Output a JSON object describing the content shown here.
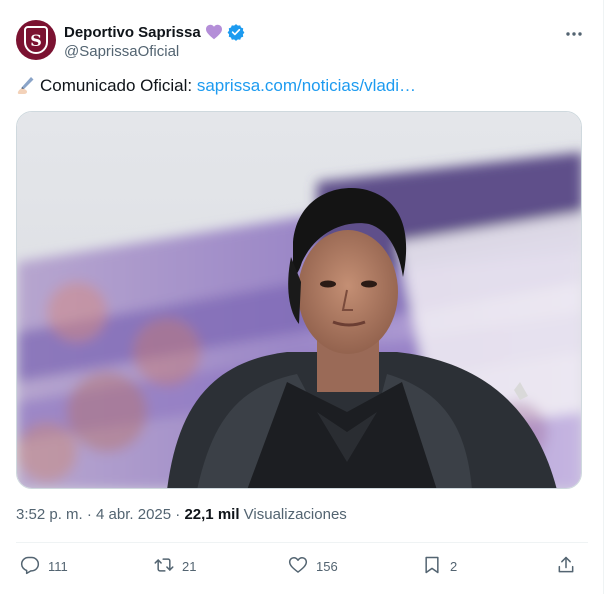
{
  "tweet": {
    "author": {
      "display_name": "Deportivo Saprissa",
      "handle": "@SaprissaOficial",
      "avatar_letter": "S",
      "avatar_color": "#7b1231",
      "name_emoji": "purple-heart-icon",
      "verified_color": "#1d9bf0"
    },
    "text_prefix": "Comunicado Oficial: ",
    "link_text": "saprissa.com/noticias/vladi…",
    "link_color": "#1d9bf0",
    "image_alt": "Photo of a man with dark hair wearing a dark jacket in front of a purple stadium crowd",
    "timestamp": "3:52 p. m. · 4 abr. 2025",
    "separator": " · ",
    "views_count": "22,1 mil",
    "views_label": "Visualizaciones",
    "actions": {
      "replies": "111",
      "retweets": "21",
      "likes": "156",
      "bookmarks": "2"
    }
  }
}
